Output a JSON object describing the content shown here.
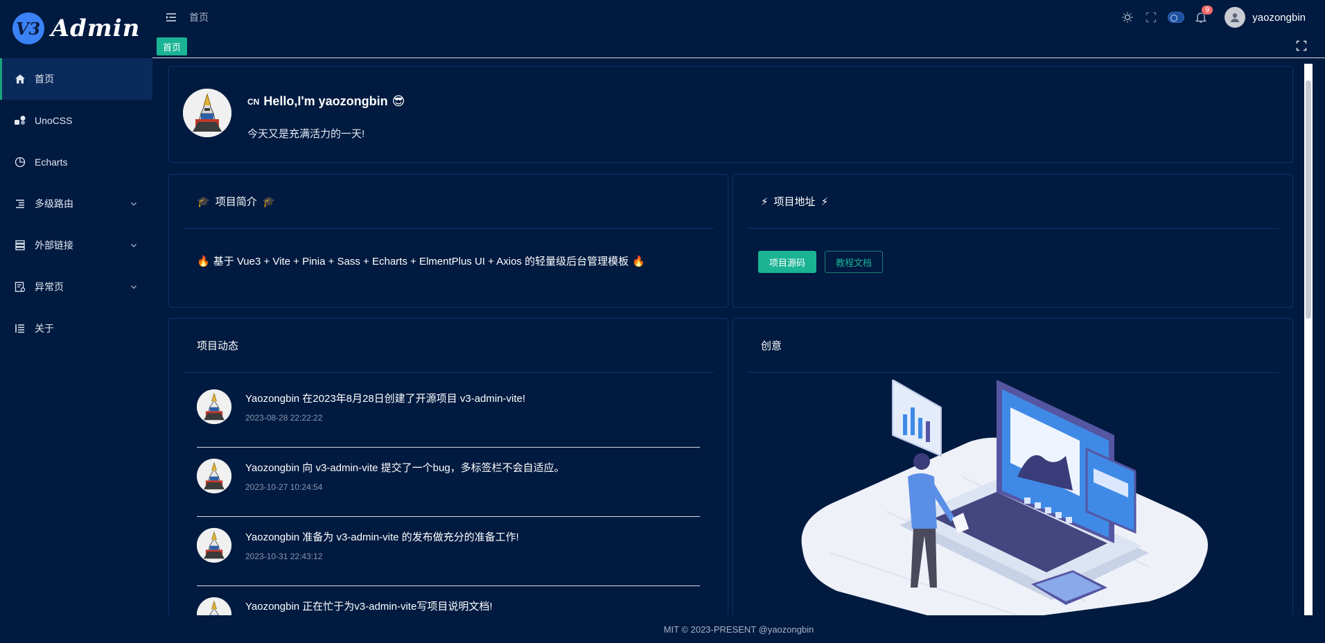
{
  "app": {
    "logo_badge": "V3",
    "logo_text": "Admin"
  },
  "sidebar": {
    "items": [
      {
        "label": "首页",
        "icon": "home-icon",
        "active": true
      },
      {
        "label": "UnoCSS",
        "icon": "shapes-icon"
      },
      {
        "label": "Echarts",
        "icon": "pie-chart-icon"
      },
      {
        "label": "多级路由",
        "icon": "menu-lines-icon",
        "expandable": true
      },
      {
        "label": "外部链接",
        "icon": "server-icon",
        "expandable": true
      },
      {
        "label": "异常页",
        "icon": "error-page-icon",
        "expandable": true
      },
      {
        "label": "关于",
        "icon": "list-icon"
      }
    ]
  },
  "header": {
    "breadcrumb": "首页",
    "notification_count": "9",
    "username": "yaozongbin"
  },
  "tags": {
    "active": "首页"
  },
  "hello": {
    "country": "CN",
    "title": "Hello,I'm yaozongbin",
    "emoji": "😎",
    "subtitle": "今天又是充满活力的一天!"
  },
  "intro": {
    "title": "项目简介",
    "icon": "🎓",
    "text": "基于 Vue3 + Vite + Pinia + Sass + Echarts + ElmentPlus UI + Axios 的轻量级后台管理模板",
    "fire": "🔥"
  },
  "address": {
    "title": "项目地址",
    "icon": "⚡",
    "source_button": "项目源码",
    "docs_button": "教程文档"
  },
  "news": {
    "title": "项目动态",
    "items": [
      {
        "text": "Yaozongbin 在2023年8月28日创建了开源项目 v3-admin-vite!",
        "time": "2023-08-28 22:22:22"
      },
      {
        "text": "Yaozongbin 向 v3-admin-vite 提交了一个bug，多标签栏不会自适应。",
        "time": "2023-10-27 10:24:54"
      },
      {
        "text": "Yaozongbin 准备为 v3-admin-vite 的发布做充分的准备工作!",
        "time": "2023-10-31 22:43:12"
      },
      {
        "text": "Yaozongbin 正在忙于为v3-admin-vite写项目说明文档!",
        "time": ""
      }
    ]
  },
  "idea": {
    "title": "创意"
  },
  "footer": {
    "text": "MIT © 2023-PRESENT @yaozongbin"
  },
  "colors": {
    "accent": "#1ab394",
    "background": "#001a40",
    "border": "#12316a",
    "badge": "#f56c6c"
  }
}
